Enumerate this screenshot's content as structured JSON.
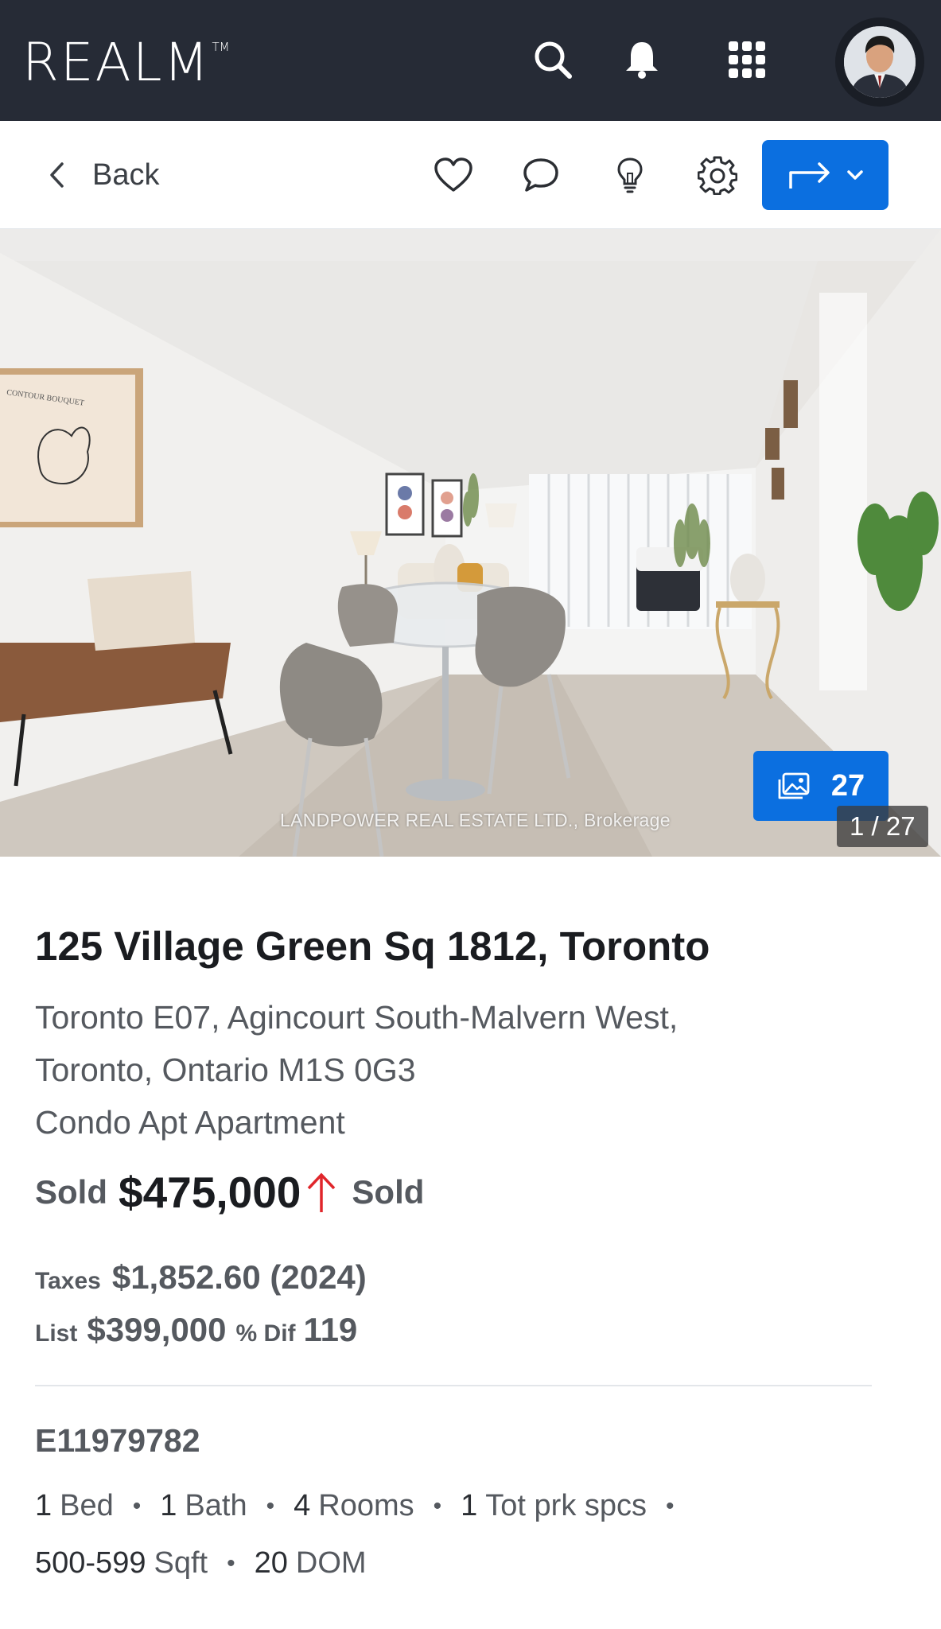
{
  "app": {
    "logo_text": "REALM",
    "logo_tm": "TM"
  },
  "appbar": {
    "icons": [
      "search-icon",
      "bell-icon",
      "apps-grid-icon",
      "avatar"
    ]
  },
  "toolbar": {
    "back_label": "Back",
    "icons": [
      "heart-icon",
      "chat-bubble-icon",
      "lightbulb-icon",
      "gear-icon",
      "share-icon",
      "chevron-down-icon"
    ],
    "accent": "#0b6fe0"
  },
  "photo": {
    "gallery_count": "27",
    "watermark": "LANDPOWER REAL ESTATE LTD., Brokerage",
    "counter": "1 / 27",
    "poster_text": "CONTOUR BOUQUET"
  },
  "listing": {
    "title": "125 Village Green Sq 1812, Toronto",
    "address_line1": "Toronto E07, Agincourt South-Malvern West,",
    "address_line2": "Toronto, Ontario M1S 0G3",
    "type": "Condo Apt Apartment",
    "price_label": "Sold",
    "price": "$475,000",
    "status": "Sold",
    "taxes_label": "Taxes",
    "taxes_value": "$1,852.60 (2024)",
    "list_label": "List",
    "list_value": "$399,000",
    "dif_label": "% Dif",
    "dif_value": "119",
    "mls": "E11979782",
    "facts": [
      {
        "num": "1",
        "unit": "Bed"
      },
      {
        "num": "1",
        "unit": "Bath"
      },
      {
        "num": "4",
        "unit": "Rooms"
      },
      {
        "num": "1",
        "unit": "Tot prk spcs"
      },
      {
        "num": "500-599",
        "unit": "Sqft"
      },
      {
        "num": "20",
        "unit": "DOM"
      }
    ],
    "price_up_color": "#e0262b"
  }
}
